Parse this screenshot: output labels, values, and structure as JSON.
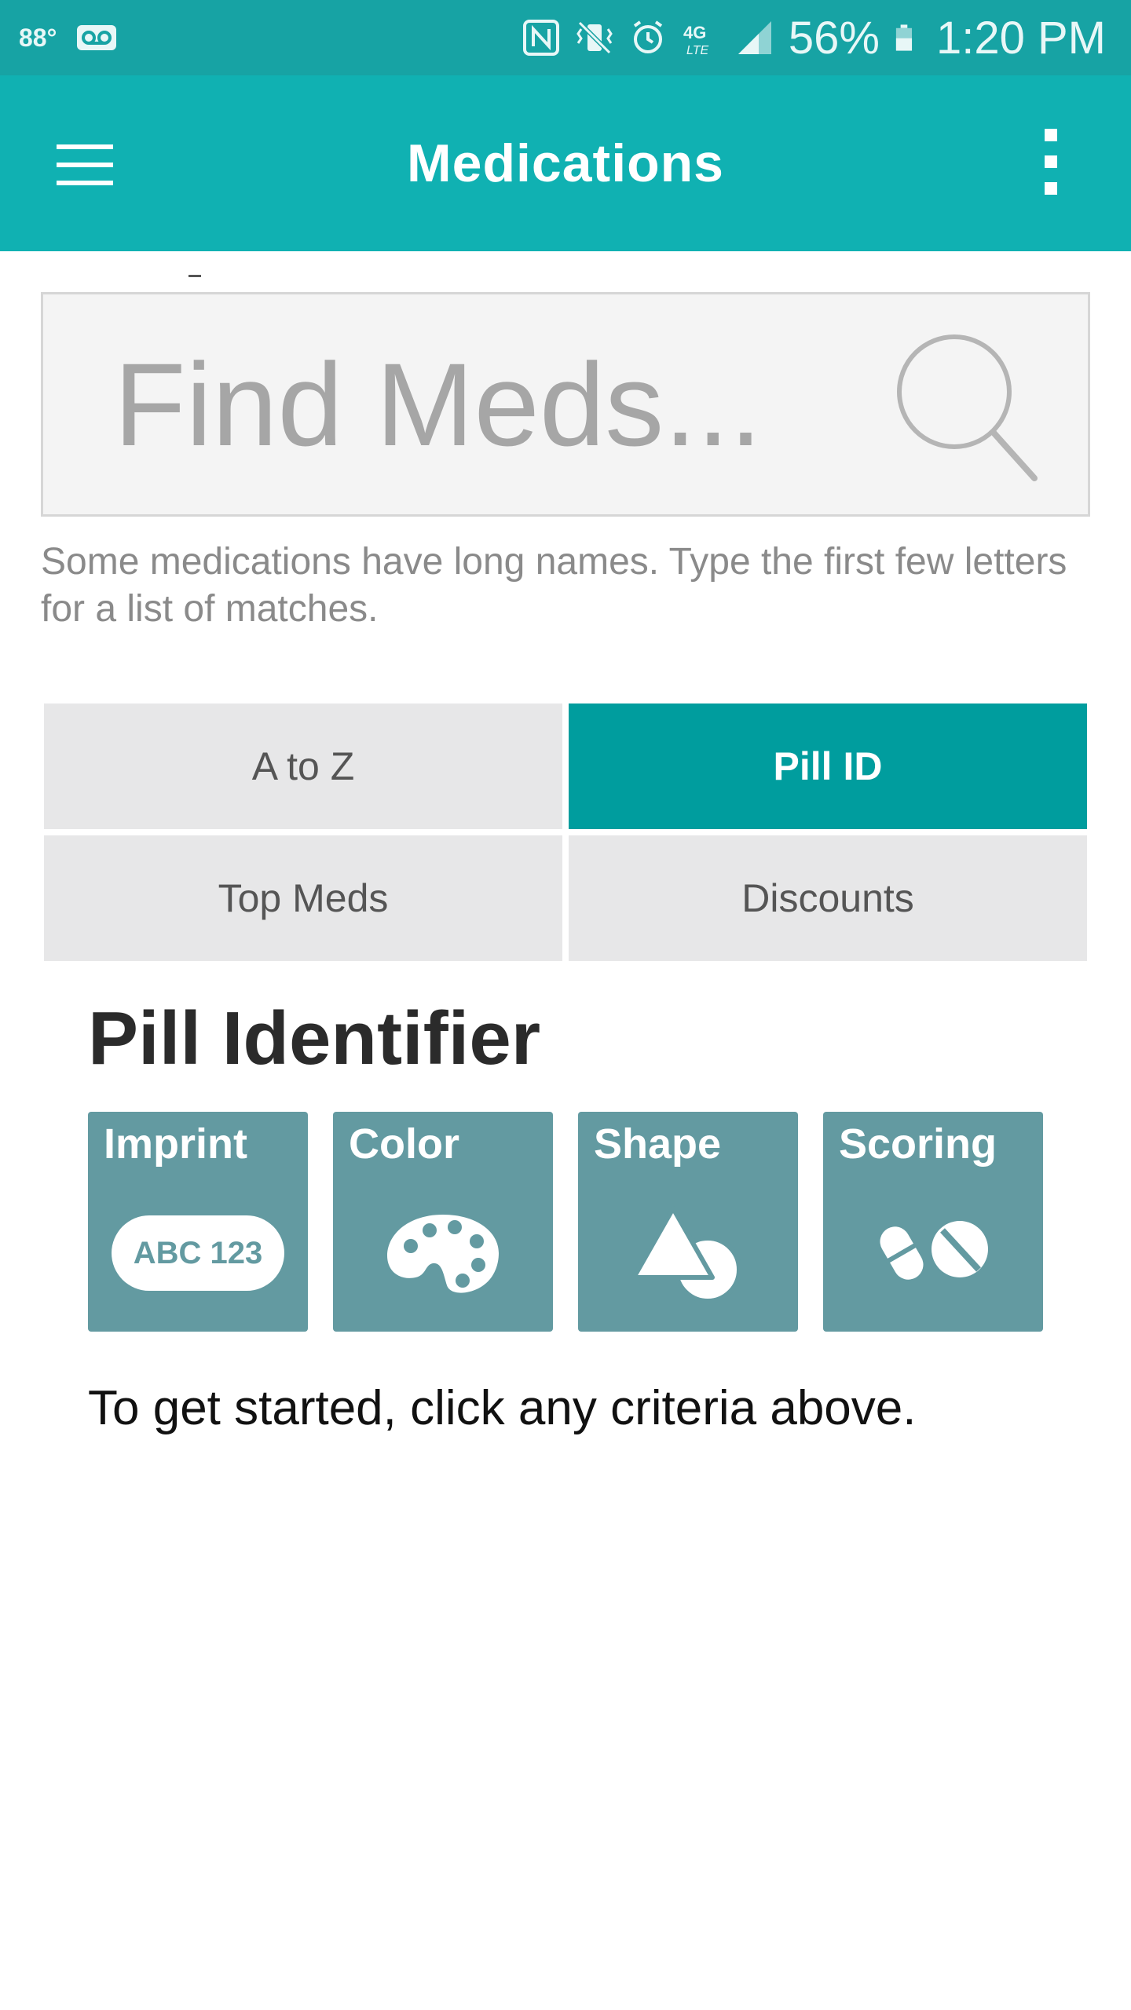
{
  "status_bar": {
    "temperature": "88°",
    "battery_percent": "56%",
    "time": "1:20 PM",
    "icons": [
      "voicemail-icon",
      "nfc-icon",
      "vibrate-icon",
      "alarm-icon",
      "lte-icon",
      "signal-icon",
      "battery-icon"
    ]
  },
  "app_bar": {
    "title": "Medications",
    "left_icon": "menu-icon",
    "right_icon": "overflow-menu-icon"
  },
  "search": {
    "placeholder": "Find Meds...",
    "value": "",
    "helper": "Some medications have long names. Type the first few letters for a list of matches."
  },
  "tabs": [
    {
      "label": "A to Z",
      "active": false
    },
    {
      "label": "Pill ID",
      "active": true
    },
    {
      "label": "Top Meds",
      "active": false
    },
    {
      "label": "Discounts",
      "active": false
    }
  ],
  "pill_identifier": {
    "title": "Pill Identifier",
    "criteria": [
      {
        "label": "Imprint",
        "sample": "ABC 123",
        "icon": "imprint-icon"
      },
      {
        "label": "Color",
        "icon": "palette-icon"
      },
      {
        "label": "Shape",
        "icon": "shape-icon"
      },
      {
        "label": "Scoring",
        "icon": "scored-pill-icon"
      }
    ],
    "instruction": "To get started, click any criteria above."
  },
  "colors": {
    "status_bar": "#17a3a4",
    "app_bar": "#10b1b2",
    "active_tab": "#009d9e",
    "tile": "#639aa1"
  }
}
